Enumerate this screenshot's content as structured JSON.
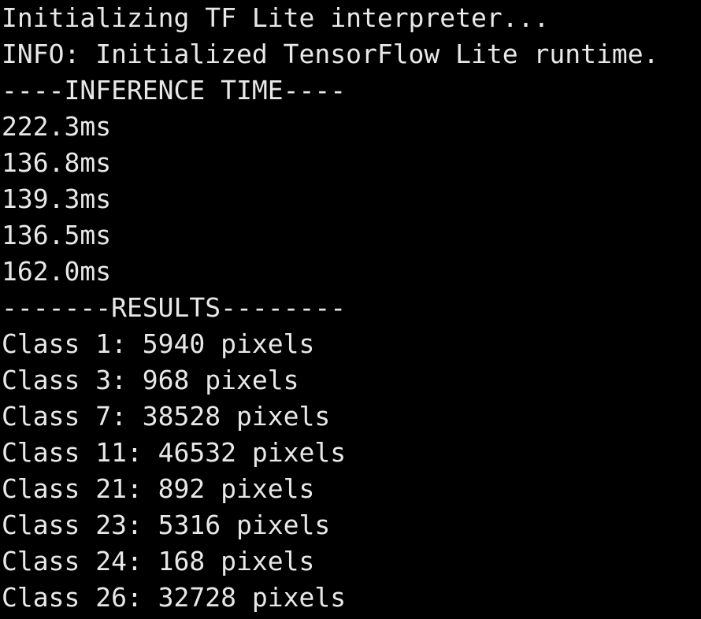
{
  "terminal": {
    "lines": [
      "Initializing TF Lite interpreter...",
      "INFO: Initialized TensorFlow Lite runtime.",
      "----INFERENCE TIME----",
      "222.3ms",
      "136.8ms",
      "139.3ms",
      "136.5ms",
      "162.0ms",
      "-------RESULTS--------",
      "Class 1: 5940 pixels",
      "Class 3: 968 pixels",
      "Class 7: 38528 pixels",
      "Class 11: 46532 pixels",
      "Class 21: 892 pixels",
      "Class 23: 5316 pixels",
      "Class 24: 168 pixels",
      "Class 26: 32728 pixels"
    ]
  },
  "colors": {
    "background": "#000000",
    "text": "#e8e8e8"
  }
}
